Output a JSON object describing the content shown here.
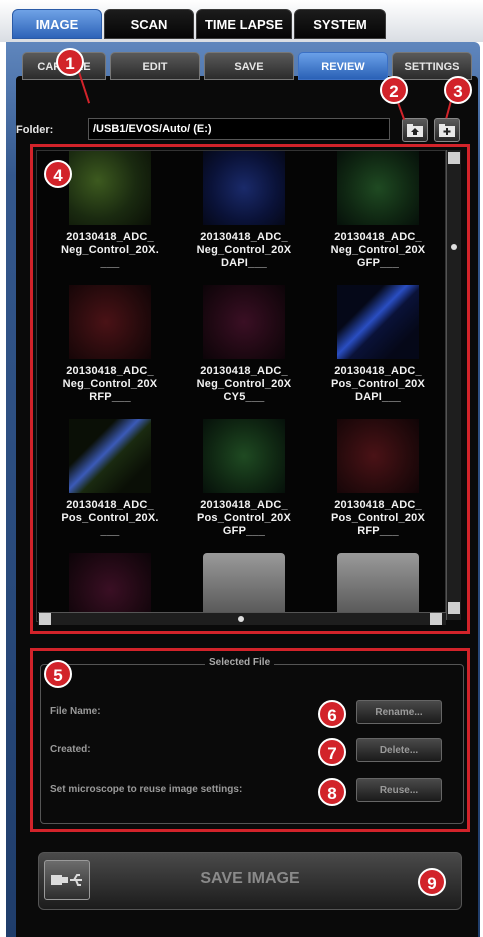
{
  "top_tabs": [
    {
      "label": "IMAGE",
      "active": true
    },
    {
      "label": "SCAN",
      "active": false
    },
    {
      "label": "TIME LAPSE",
      "active": false
    },
    {
      "label": "SYSTEM",
      "active": false
    }
  ],
  "sub_tabs": [
    {
      "label": "CAPTURE",
      "active": false
    },
    {
      "label": "EDIT",
      "active": false
    },
    {
      "label": "SAVE",
      "active": false
    },
    {
      "label": "REVIEW",
      "active": true
    },
    {
      "label": "SETTINGS",
      "active": false
    }
  ],
  "folder": {
    "label": "Folder:",
    "path": "/USB1/EVOS/Auto/  (E:)"
  },
  "files": [
    {
      "name_lines": [
        "20130418_ADC_",
        "Neg_Control_20X.",
        "___"
      ],
      "tint": "olive"
    },
    {
      "name_lines": [
        "20130418_ADC_",
        "Neg_Control_20X",
        "DAPI___"
      ],
      "tint": "blue"
    },
    {
      "name_lines": [
        "20130418_ADC_",
        "Neg_Control_20X",
        "GFP___"
      ],
      "tint": "green"
    },
    {
      "name_lines": [
        "20130418_ADC_",
        "Neg_Control_20X",
        "RFP___"
      ],
      "tint": "red"
    },
    {
      "name_lines": [
        "20130418_ADC_",
        "Neg_Control_20X",
        "CY5___"
      ],
      "tint": "magenta"
    },
    {
      "name_lines": [
        "20130418_ADC_",
        "Pos_Control_20X",
        "DAPI___"
      ],
      "tint": "blue-streak"
    },
    {
      "name_lines": [
        "20130418_ADC_",
        "Pos_Control_20X.",
        "___"
      ],
      "tint": "mixed-streak"
    },
    {
      "name_lines": [
        "20130418_ADC_",
        "Pos_Control_20X",
        "GFP___"
      ],
      "tint": "green"
    },
    {
      "name_lines": [
        "20130418_ADC_",
        "Pos_Control_20X",
        "RFP___"
      ],
      "tint": "red"
    },
    {
      "name_lines": [
        "",
        "",
        ""
      ],
      "tint": "magenta"
    },
    {
      "name_lines": [
        "",
        "",
        ""
      ],
      "tint": "folder"
    },
    {
      "name_lines": [
        "",
        "",
        ""
      ],
      "tint": "folder"
    }
  ],
  "selected_file": {
    "legend": "Selected File",
    "file_name_label": "File Name:",
    "created_label": "Created:",
    "reuse_text": "Set microscope to reuse image settings:",
    "rename_button": "Rename...",
    "delete_button": "Delete...",
    "reuse_button": "Reuse..."
  },
  "save_image_label": "SAVE IMAGE",
  "callouts": [
    "1",
    "2",
    "3",
    "4",
    "5",
    "6",
    "7",
    "8",
    "9"
  ],
  "colors": {
    "callout_red": "#d2232a",
    "active_tab_blue": "#2d63b8",
    "panel_blue": "#34588d"
  },
  "icons": {
    "folder_up": "folder-up-icon",
    "folder_new": "folder-new-icon",
    "usb": "usb-icon"
  }
}
